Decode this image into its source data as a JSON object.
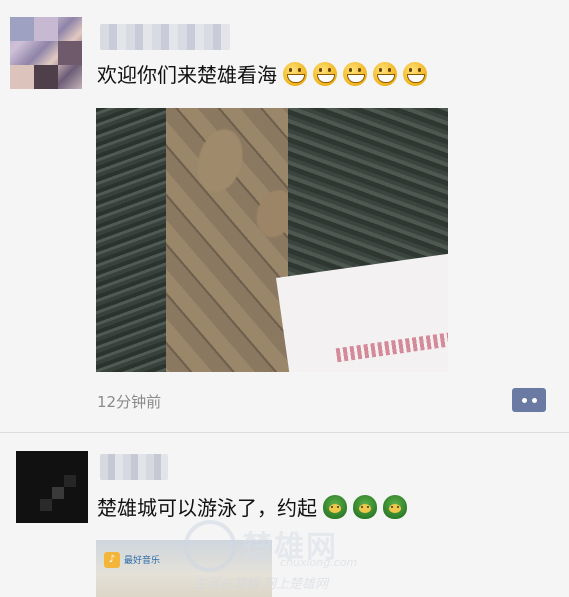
{
  "posts": [
    {
      "text": "欢迎你们来楚雄看海",
      "emojis": [
        "grin-emoji",
        "grin-emoji",
        "grin-emoji",
        "grin-emoji",
        "grin-emoji"
      ],
      "time": "12分钟前"
    },
    {
      "text": "楚雄城可以游泳了，约起",
      "emojis": [
        "turtle-emoji",
        "turtle-emoji",
        "turtle-emoji"
      ],
      "thumbnail": {
        "logo_text": "最好音乐"
      }
    }
  ],
  "watermark": {
    "big": "楚雄网",
    "url": "chuxiong.com",
    "slogan": "生活在楚雄 网上楚雄网"
  },
  "icons": {
    "comment": "comment-dots-icon"
  },
  "colors": {
    "background": "#f5f5f5",
    "comment_button": "#6a7aa2",
    "time_text": "#8a8a8a"
  }
}
